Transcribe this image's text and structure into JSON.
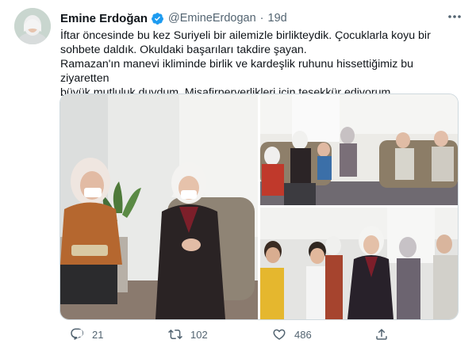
{
  "tweet": {
    "author": {
      "name": "Emine Erdoğan",
      "handle": "@EmineErdogan",
      "separator": "·",
      "age": "19d"
    },
    "text": {
      "line1": "İftar öncesinde bu kez Suriyeli bir ailemizle birlikteydik. Çocuklarla koyu bir",
      "line2": "sohbete daldık. Okuldaki başarıları takdire şayan.",
      "line3": "Ramazan'ın manevi ikliminde birlik ve kardeşlik ruhunu hissettiğimiz bu ziyaretten",
      "line4": "büyük mutluluk duydum. Misafirperverlikleri için teşekkür ediyorum"
    },
    "actions": {
      "replies": "21",
      "retweets": "102",
      "likes": "486"
    }
  },
  "colors": {
    "verified": "#1d9bf0",
    "secondary_text": "#536471",
    "border": "#cfd9de"
  },
  "icons": [
    "verified-badge-icon",
    "more-icon",
    "reply-icon",
    "retweet-icon",
    "like-icon",
    "share-icon"
  ]
}
